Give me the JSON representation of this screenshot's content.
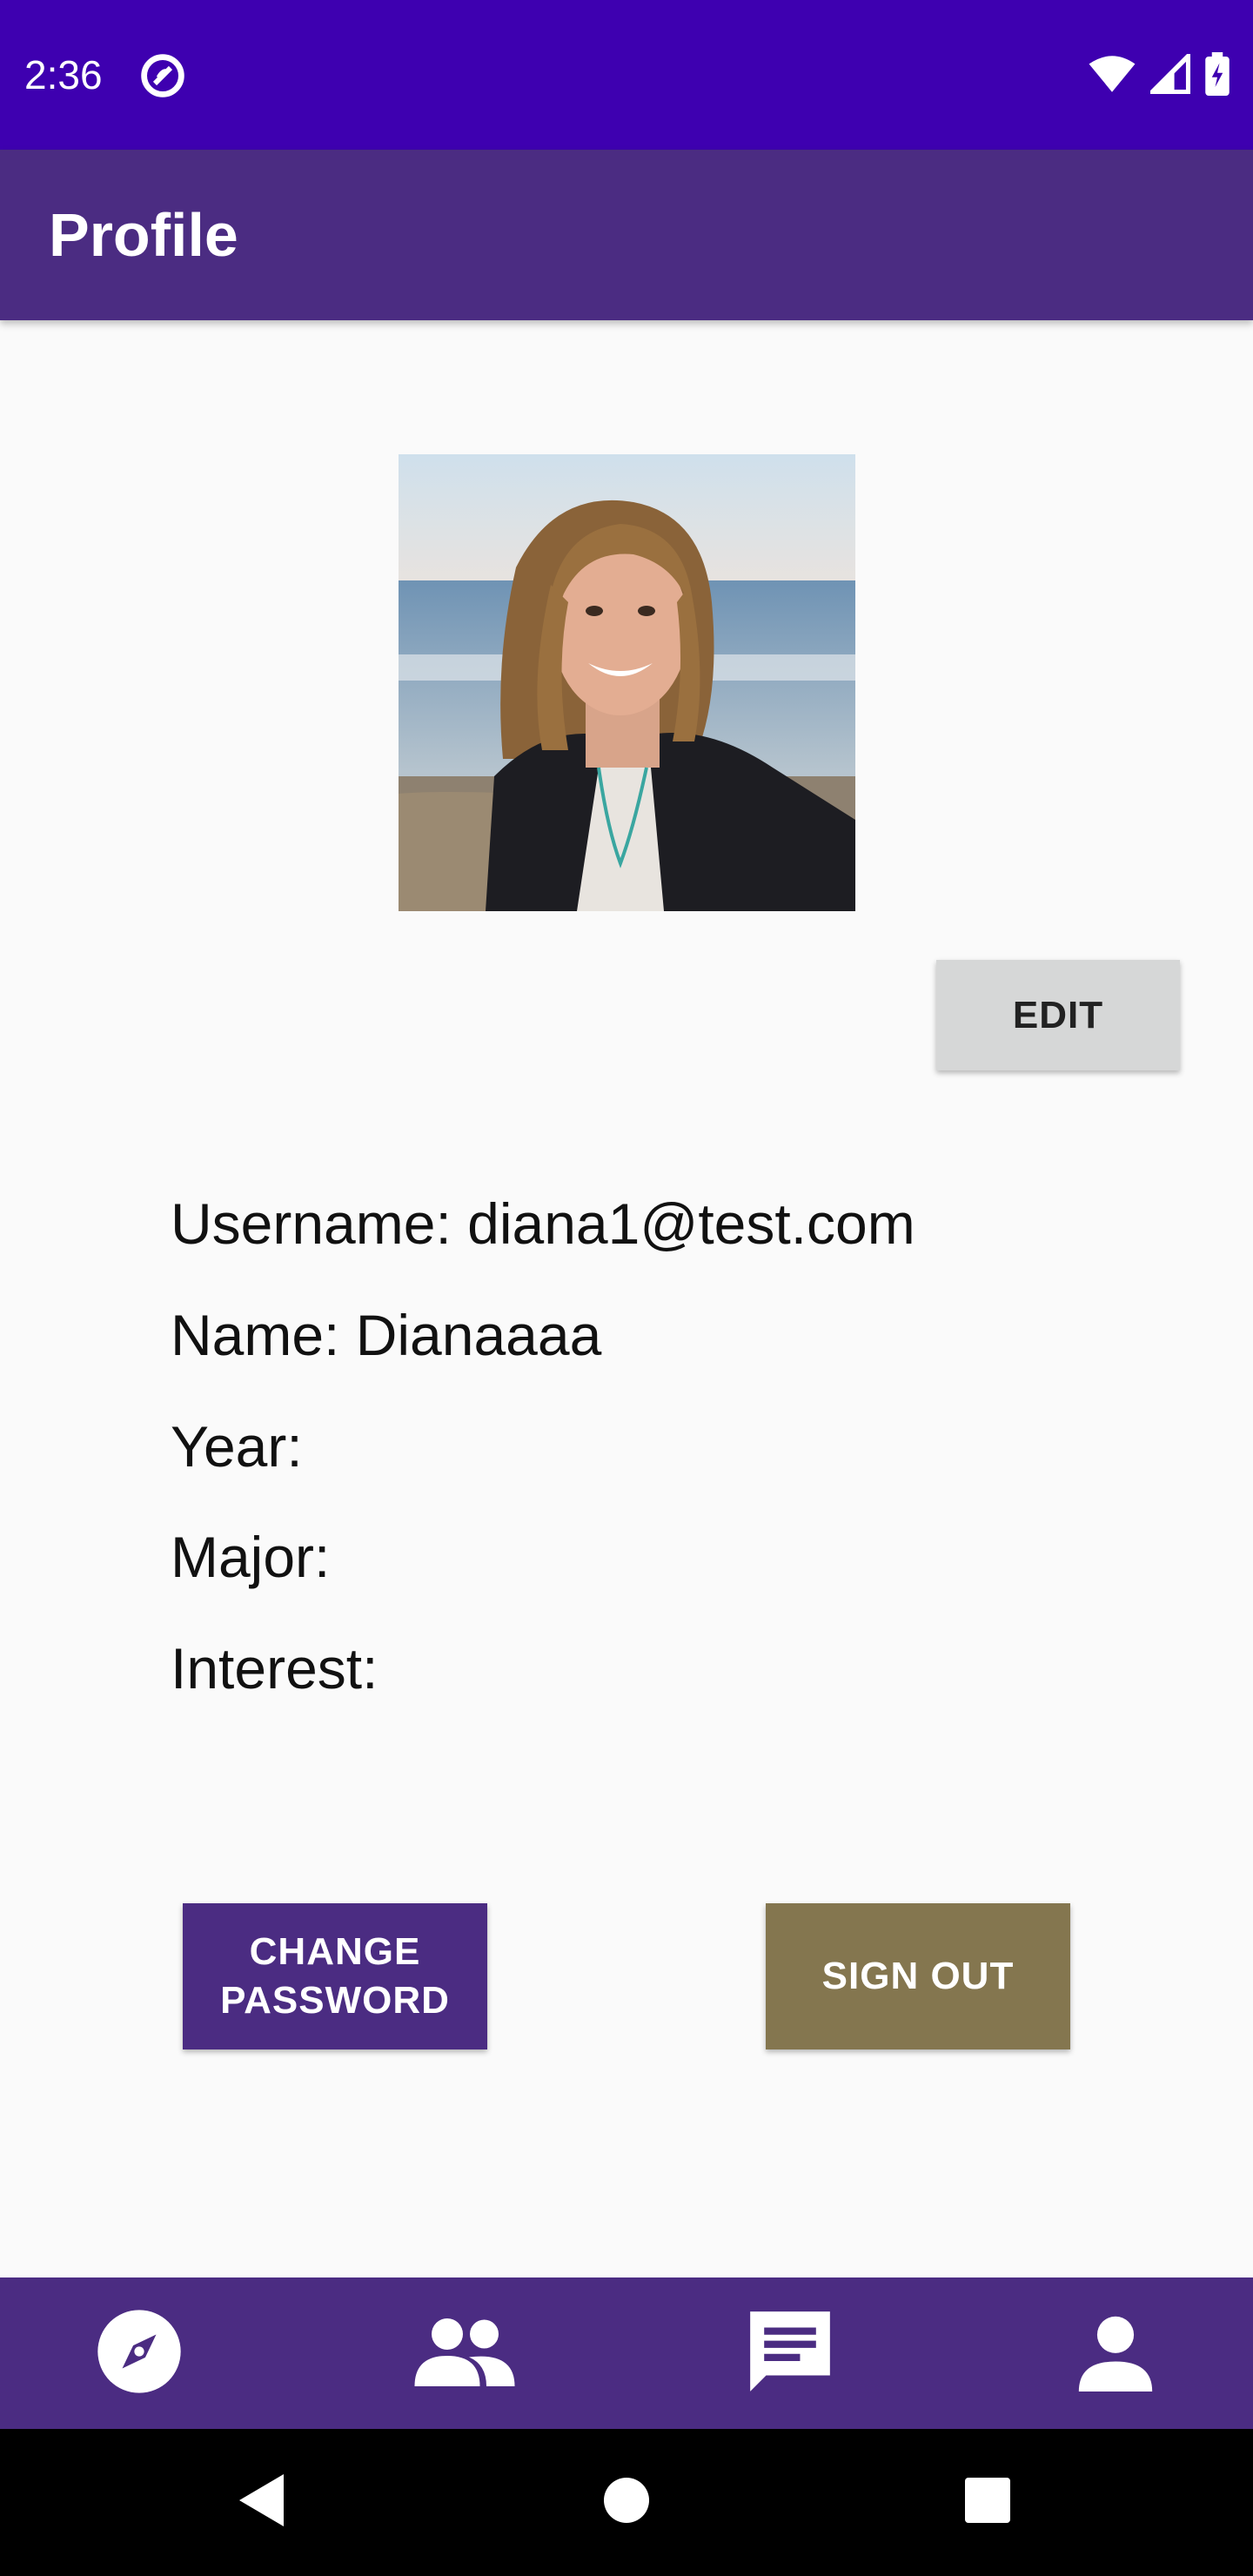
{
  "status_bar": {
    "time": "2:36",
    "icons": [
      "do-not-disturb-icon",
      "wifi-icon",
      "signal-icon",
      "battery-charging-icon"
    ]
  },
  "app_bar": {
    "title": "Profile"
  },
  "profile": {
    "avatar": "profile-photo",
    "edit_label": "EDIT",
    "fields": [
      {
        "label": "Username:",
        "value": "diana1@test.com"
      },
      {
        "label": "Name:",
        "value": "Dianaaaa"
      },
      {
        "label": "Year:",
        "value": ""
      },
      {
        "label": "Major:",
        "value": ""
      },
      {
        "label": "Interest:",
        "value": ""
      }
    ]
  },
  "actions": {
    "change_password_line1": "CHANGE",
    "change_password_line2": "PASSWORD",
    "sign_out": "SIGN OUT"
  },
  "bottom_nav": {
    "items": [
      "compass-icon",
      "people-icon",
      "chat-icon",
      "person-icon"
    ]
  },
  "system_nav": [
    "back-icon",
    "home-icon",
    "recents-icon"
  ],
  "colors": {
    "status_bar": "#3e00b0",
    "primary": "#4b2c82",
    "sign_out": "#84764f",
    "edit": "#d6d7d7",
    "background": "#fafafa"
  }
}
